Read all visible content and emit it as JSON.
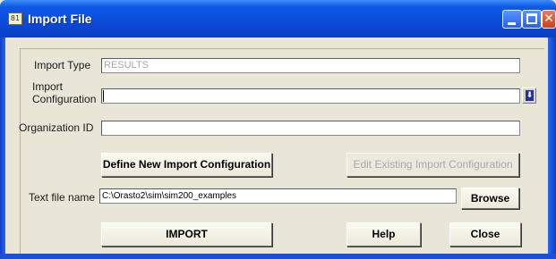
{
  "window": {
    "title": "Import File",
    "app_icon_glyph": "81"
  },
  "title_buttons": {
    "close_glyph": "✕"
  },
  "form": {
    "import_type": {
      "label": "Import Type",
      "value": "RESULTS"
    },
    "import_configuration": {
      "label_line1": "Import",
      "label_line2": "Configuration",
      "value": ""
    },
    "organization_id": {
      "label": "Organization ID",
      "value": ""
    },
    "text_file_name": {
      "label": "Text file name",
      "value": "C:\\Orasto2\\sim\\sim200_examples"
    },
    "dropdown_glyph": "⬇"
  },
  "buttons": {
    "define_new": "Define New Import Configuration",
    "edit_existing": "Edit Existing Import Configuration",
    "browse": "Browse",
    "import": "IMPORT",
    "help": "Help",
    "close": "Close"
  },
  "colors": {
    "titlebar": "#0a4ad8",
    "window_bg": "#e9e6d8",
    "disabled_text": "#a9a9a9"
  }
}
